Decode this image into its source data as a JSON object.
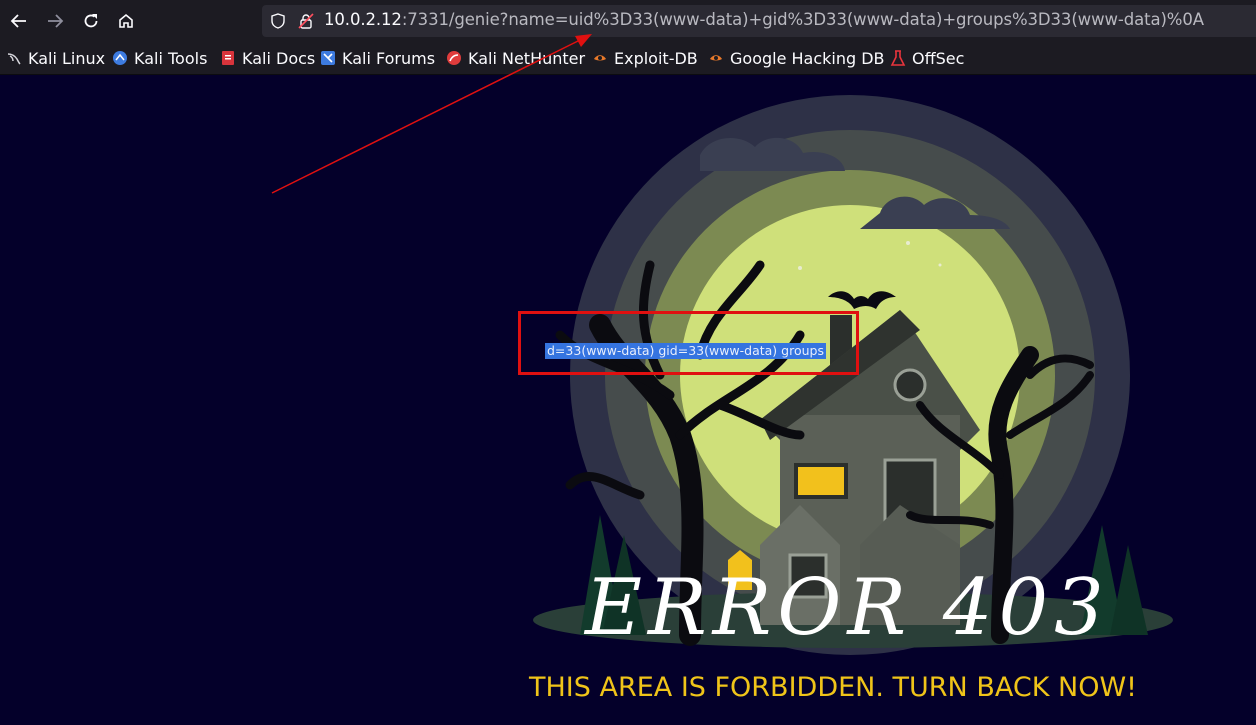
{
  "browser": {
    "url_host": "10.0.2.12",
    "url_rest": ":7331/genie?name=uid%3D33(www-data)+gid%3D33(www-data)+groups%3D33(www-data)%0A",
    "nav": [
      "back-icon",
      "forward-icon",
      "reload-icon",
      "home-icon"
    ]
  },
  "bookmarks": [
    {
      "label": "Kali Linux",
      "icon": "kali-dragon-icon"
    },
    {
      "label": "Kali Tools",
      "icon": "kali-tools-icon"
    },
    {
      "label": "Kali Docs",
      "icon": "kali-docs-icon"
    },
    {
      "label": "Kali Forums",
      "icon": "kali-forums-icon"
    },
    {
      "label": "Kali NetHunter",
      "icon": "kali-nethunter-icon"
    },
    {
      "label": "Exploit-DB",
      "icon": "exploit-db-icon"
    },
    {
      "label": "Google Hacking DB",
      "icon": "ghdb-icon"
    },
    {
      "label": "OffSec",
      "icon": "offsec-icon"
    }
  ],
  "page": {
    "command_output": "d=33(www-data) gid=33(www-data) groups",
    "error_title": "ERROR 403",
    "error_subtitle": "THIS AREA IS FORBIDDEN. TURN BACK NOW!"
  },
  "colors": {
    "background": "#04002a",
    "moon": "#cfe07a",
    "title": "#ffffff",
    "subtitle": "#f0c419",
    "annotation": "#e01010",
    "selection": "#3574e0"
  }
}
